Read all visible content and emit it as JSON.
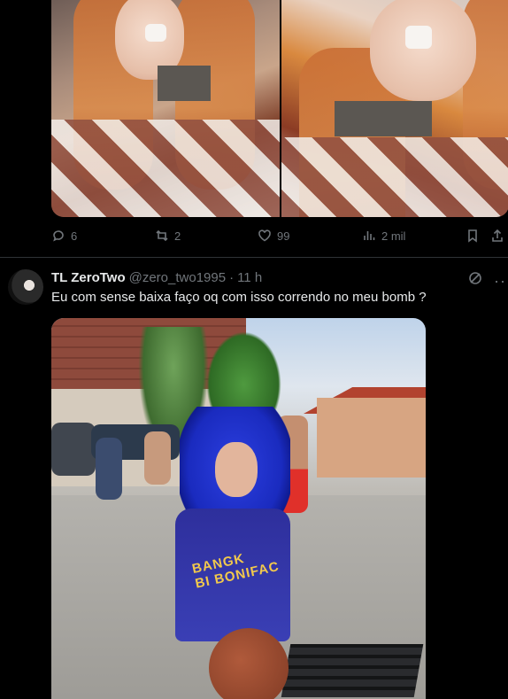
{
  "top_tweet": {
    "stats": {
      "replies": "6",
      "reposts": "2",
      "likes": "99",
      "views": "2 mil"
    }
  },
  "tweet": {
    "author_name": "TL ZeroTwo",
    "handle": "@zero_two1995",
    "separator": "·",
    "time": "11 h",
    "text": "Eu com sense baixa faço oq com isso correndo no meu bomb ?",
    "image_jersey_text": "BANGK\nBI BONIFAC"
  },
  "icons": {
    "reply": "reply-icon",
    "repost": "repost-icon",
    "like": "heart-icon",
    "views": "views-icon",
    "bookmark": "bookmark-icon",
    "share": "share-icon",
    "grok": "grok-icon",
    "more": "more-icon"
  },
  "colors": {
    "background": "#000000",
    "text": "#e7e9ea",
    "muted": "#71767b",
    "divider": "#2f3336"
  }
}
